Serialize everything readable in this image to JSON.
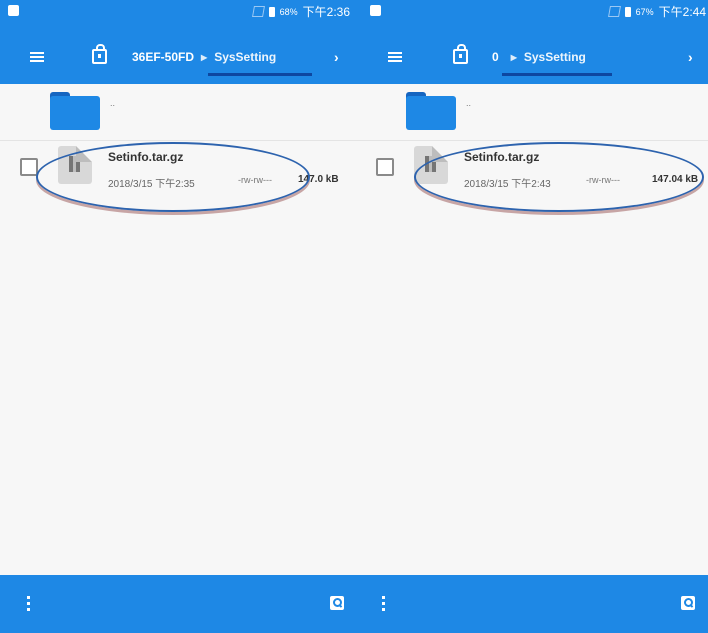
{
  "panels": [
    {
      "status": {
        "battery": "68%",
        "time": "下午2:36"
      },
      "breadcrumb": {
        "segment1": "36EF-50FD",
        "segment2": "SysSetting"
      },
      "updir_label": "..",
      "file": {
        "name": "Setinfo.tar.gz",
        "date": "2018/3/15 下午2:35",
        "perms": "-rw-rw---",
        "size": "147.0 kB"
      }
    },
    {
      "status": {
        "battery": "67%",
        "time": "下午2:44"
      },
      "breadcrumb": {
        "segment1": "0",
        "segment2": "SysSetting"
      },
      "updir_label": "..",
      "file": {
        "name": "Setinfo.tar.gz",
        "date": "2018/3/15 下午2:43",
        "perms": "-rw-rw---",
        "size": "147.04 kB"
      }
    }
  ],
  "icons": [
    "menu-icon",
    "lock-icon",
    "chevron-right-icon",
    "folder-icon",
    "archive-file-icon",
    "more-vert-icon",
    "search-icon"
  ],
  "colors": {
    "accent": "#1e88e5",
    "highlight_ring": "#2d63ae"
  }
}
